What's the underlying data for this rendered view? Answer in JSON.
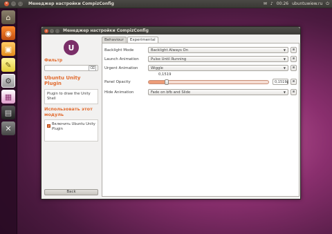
{
  "top_panel": {
    "window_title": "Менеджер настройки CompizConfig",
    "tray": {
      "mail": "✉",
      "volume": "♪",
      "clock": "00:26",
      "user": "ubuntuwiew.ru",
      "power": "⏻"
    }
  },
  "launcher": {
    "items": [
      {
        "name": "home-folder",
        "glyph": "⌂"
      },
      {
        "name": "firefox",
        "glyph": "◉"
      },
      {
        "name": "virtualbox",
        "glyph": "▣"
      },
      {
        "name": "notes",
        "glyph": "✎"
      },
      {
        "name": "ccsm",
        "glyph": "⚙"
      },
      {
        "name": "image-viewer",
        "glyph": "▦"
      },
      {
        "name": "terminal",
        "glyph": "▤"
      },
      {
        "name": "settings",
        "glyph": "✕"
      }
    ]
  },
  "window": {
    "title": "Менеджер настройки CompizConfig"
  },
  "sidebar": {
    "logo_text": "U",
    "filter_label": "Фильтр",
    "filter_value": "",
    "plugin_title": "Ubuntu Unity Plugin",
    "plugin_description": "Plugin to draw the Unity Shell",
    "use_title": "Использовать этот модуль",
    "enable_label": "Включить Ubuntu Unity Plugin",
    "enable_checked": true,
    "back_label": "Back"
  },
  "tabs": [
    {
      "label": "Behaviour",
      "active": false
    },
    {
      "label": "Experimental",
      "active": true
    }
  ],
  "settings": {
    "backlight_mode": {
      "label": "Backlight Mode",
      "value": "Backlight Always On"
    },
    "launch_animation": {
      "label": "Launch Animation",
      "value": "Pulse Until Running"
    },
    "urgent_animation": {
      "label": "Urgent Animation",
      "value": "Wiggle"
    },
    "panel_opacity": {
      "label": "Panel Opacity",
      "value_text": "0,1519",
      "spin_text": "0,1519",
      "fraction": 0.1519
    },
    "hide_animation": {
      "label": "Hide Animation",
      "value": "Fade on bfb and Slide"
    }
  },
  "colors": {
    "accent": "#e26b2e",
    "ubuntu_purple": "#7a2e68"
  },
  "icons": {
    "dropdown": "▼",
    "reset": "⊞",
    "clear": "⌫"
  }
}
